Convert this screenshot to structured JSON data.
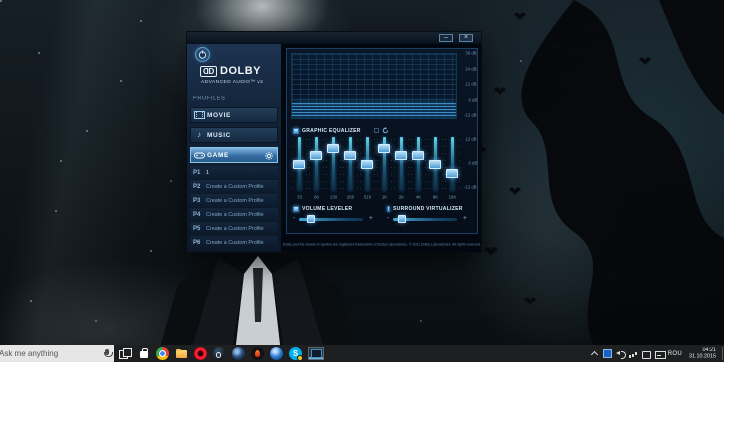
{
  "window": {
    "titlebar": {
      "minimize_glyph": "–",
      "close_glyph": "×"
    },
    "brand": {
      "dd_left": "D",
      "dd_right": "D",
      "name": "DOLBY",
      "subtitle": "ADVANCED AUDIO™ v2"
    },
    "icons": [
      "power-icon",
      "film-icon",
      "music-note-icon",
      "gamepad-icon",
      "gear-icon",
      "reset-icon"
    ],
    "profiles": {
      "header": "PROFILES",
      "items": [
        {
          "label": "MOVIE",
          "icon": "film-icon",
          "selected": false
        },
        {
          "label": "MUSIC",
          "icon": "music-note-icon",
          "selected": false
        },
        {
          "label": "GAME",
          "icon": "gamepad-icon",
          "selected": true
        }
      ],
      "custom": [
        {
          "key": "P1",
          "label": "1"
        },
        {
          "key": "P2",
          "label": "Create a Custom Profile"
        },
        {
          "key": "P3",
          "label": "Create a Custom Profile"
        },
        {
          "key": "P4",
          "label": "Create a Custom Profile"
        },
        {
          "key": "P5",
          "label": "Create a Custom Profile"
        },
        {
          "key": "P6",
          "label": "Create a Custom Profile"
        }
      ]
    },
    "graph": {
      "scale_labels": [
        "36 dB",
        "24 dB",
        "12 dB",
        "0 dB",
        "-12 dB"
      ]
    },
    "equalizer": {
      "label": "GRAPHIC EQUALIZER",
      "enabled": true,
      "range_db": [
        -12,
        12
      ],
      "scale_labels": [
        "12 dB",
        "0 dB",
        "-12 dB"
      ],
      "bands": [
        {
          "freq": "33",
          "db": 0
        },
        {
          "freq": "66",
          "db": 4
        },
        {
          "freq": "130",
          "db": 7
        },
        {
          "freq": "260",
          "db": 4
        },
        {
          "freq": "510",
          "db": 0
        },
        {
          "freq": "1K",
          "db": 7
        },
        {
          "freq": "2K",
          "db": 4
        },
        {
          "freq": "4K",
          "db": 4
        },
        {
          "freq": "8K",
          "db": 0
        },
        {
          "freq": "16K",
          "db": -4
        }
      ]
    },
    "toggles": [
      {
        "label": "VOLUME LEVELER",
        "checked": true,
        "value_percent": 12,
        "minus": "-",
        "plus": "+"
      },
      {
        "label": "SURROUND VIRTUALIZER",
        "checked": true,
        "value_percent": 8,
        "minus": "-",
        "plus": "+"
      }
    ],
    "footer": "Dolby and the double-D symbol are registered trademarks of Dolby Laboratories. © 2011 Dolby Laboratories. All rights reserved."
  },
  "taskbar": {
    "search": {
      "placeholder": "Ask me anything"
    },
    "skype_letter": "S",
    "app_icons": [
      "task-view-icon",
      "store-icon",
      "chrome-icon",
      "file-explorer-icon",
      "opera-icon",
      "steam-icon",
      "globe-browser-icon",
      "flame-app-icon",
      "blue-app-icon",
      "skype-icon",
      "dolby-window-icon"
    ],
    "tray_icons": [
      "hidden-icons-chevron",
      "dolby-tray-icon",
      "volume-icon",
      "network-icon",
      "onedrive-icon",
      "touch-keyboard-icon"
    ],
    "tray": {
      "language": "ROU",
      "time": "04:21",
      "date": "31.10.2015"
    }
  }
}
